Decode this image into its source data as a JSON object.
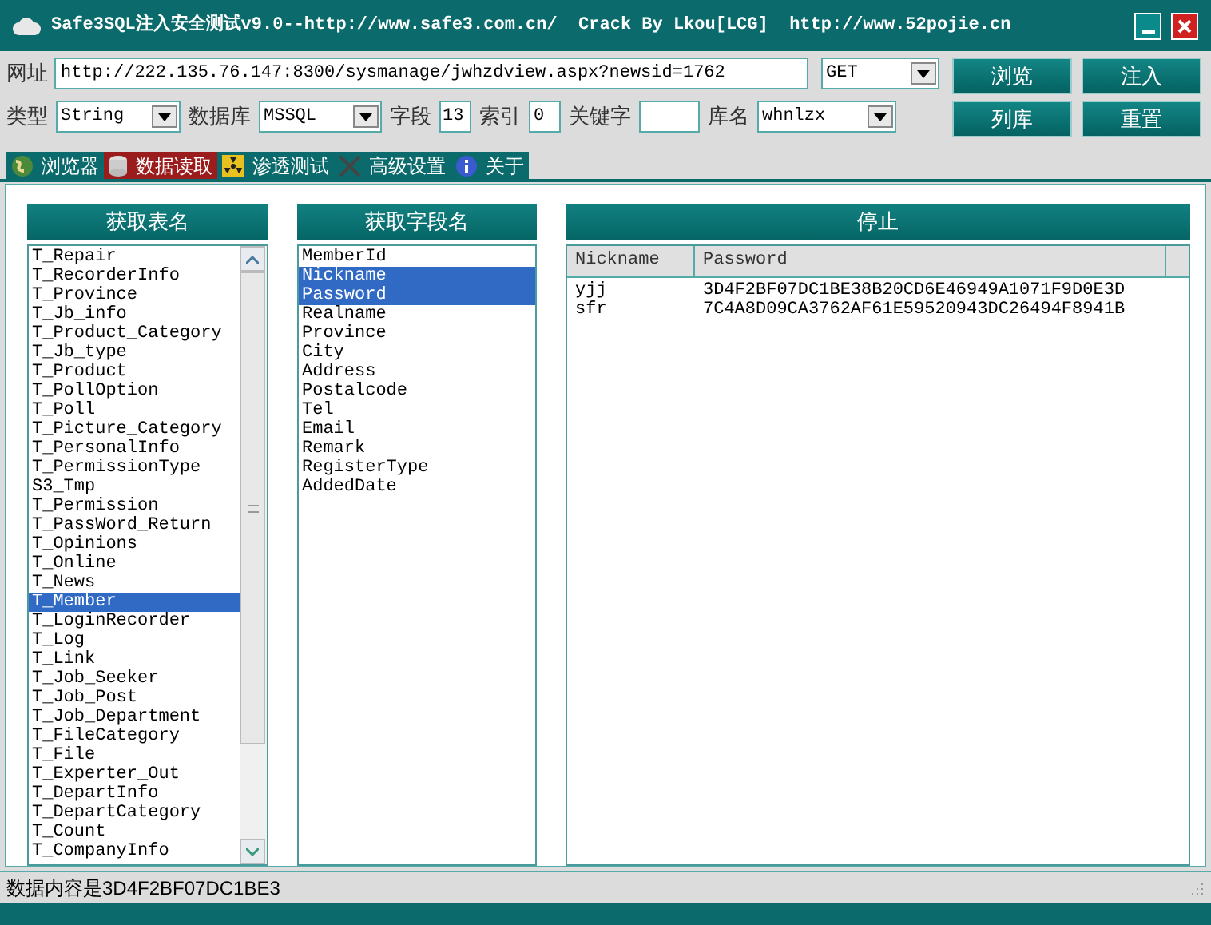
{
  "window": {
    "title": "Safe3SQL注入安全测试v9.0--http://www.safe3.com.cn/  Crack By Lkou[LCG]  http://www.52pojie.cn"
  },
  "form": {
    "url_label": "网址",
    "url": "http://222.135.76.147:8300/sysmanage/jwhzdview.aspx?newsid=1762",
    "method": "GET",
    "type_label": "类型",
    "type": "String",
    "db_label": "数据库",
    "db": "MSSQL",
    "fields_label": "字段",
    "fields": "13",
    "index_label": "索引",
    "index": "0",
    "keyword_label": "关键字",
    "dbname_label": "库名",
    "dbname": "whnlzx"
  },
  "buttons": [
    "浏览",
    "注入",
    "列库",
    "重置"
  ],
  "tabs": [
    {
      "label": "浏览器",
      "selected": false
    },
    {
      "label": "数据读取",
      "selected": true
    },
    {
      "label": "渗透测试",
      "selected": false
    },
    {
      "label": "高级设置",
      "selected": false
    },
    {
      "label": "关于",
      "selected": false
    }
  ],
  "tables_panel": {
    "header": "获取表名",
    "items": [
      {
        "label": "T_Repair",
        "selected": false
      },
      {
        "label": "T_RecorderInfo",
        "selected": false
      },
      {
        "label": "T_Province",
        "selected": false
      },
      {
        "label": "T_Jb_info",
        "selected": false
      },
      {
        "label": "T_Product_Category",
        "selected": false
      },
      {
        "label": "T_Jb_type",
        "selected": false
      },
      {
        "label": "T_Product",
        "selected": false
      },
      {
        "label": "T_PollOption",
        "selected": false
      },
      {
        "label": "T_Poll",
        "selected": false
      },
      {
        "label": "T_Picture_Category",
        "selected": false
      },
      {
        "label": "T_PersonalInfo",
        "selected": false
      },
      {
        "label": "T_PermissionType",
        "selected": false
      },
      {
        "label": "S3_Tmp",
        "selected": false
      },
      {
        "label": "T_Permission",
        "selected": false
      },
      {
        "label": "T_PassWord_Return",
        "selected": false
      },
      {
        "label": "T_Opinions",
        "selected": false
      },
      {
        "label": "T_Online",
        "selected": false
      },
      {
        "label": "T_News",
        "selected": false
      },
      {
        "label": "T_Member",
        "selected": true
      },
      {
        "label": "T_LoginRecorder",
        "selected": false
      },
      {
        "label": "T_Log",
        "selected": false
      },
      {
        "label": "T_Link",
        "selected": false
      },
      {
        "label": "T_Job_Seeker",
        "selected": false
      },
      {
        "label": "T_Job_Post",
        "selected": false
      },
      {
        "label": "T_Job_Department",
        "selected": false
      },
      {
        "label": "T_FileCategory",
        "selected": false
      },
      {
        "label": "T_File",
        "selected": false
      },
      {
        "label": "T_Experter_Out",
        "selected": false
      },
      {
        "label": "T_DepartInfo",
        "selected": false
      },
      {
        "label": "T_DepartCategory",
        "selected": false
      },
      {
        "label": "T_Count",
        "selected": false
      },
      {
        "label": "T_CompanyInfo",
        "selected": false
      }
    ]
  },
  "fields_panel": {
    "header": "获取字段名",
    "items": [
      {
        "label": "MemberId",
        "selected": false
      },
      {
        "label": "Nickname",
        "selected": true
      },
      {
        "label": "Password",
        "selected": true
      },
      {
        "label": "Realname",
        "selected": false
      },
      {
        "label": "Province",
        "selected": false
      },
      {
        "label": "City",
        "selected": false
      },
      {
        "label": "Address",
        "selected": false
      },
      {
        "label": "Postalcode",
        "selected": false
      },
      {
        "label": "Tel",
        "selected": false
      },
      {
        "label": "Email",
        "selected": false
      },
      {
        "label": "Remark",
        "selected": false
      },
      {
        "label": "RegisterType",
        "selected": false
      },
      {
        "label": "AddedDate",
        "selected": false
      }
    ]
  },
  "results_panel": {
    "header": "停止",
    "table": {
      "columns": [
        "Nickname",
        "Password"
      ],
      "rows": [
        [
          "yjj",
          "3D4F2BF07DC1BE38B20CD6E46949A1071F9D0E3D"
        ],
        [
          "sfr",
          "7C4A8D09CA3762AF61E59520943DC26494F8941B"
        ]
      ]
    }
  },
  "status_bar": "数据内容是3D4F2BF07DC1BE3"
}
